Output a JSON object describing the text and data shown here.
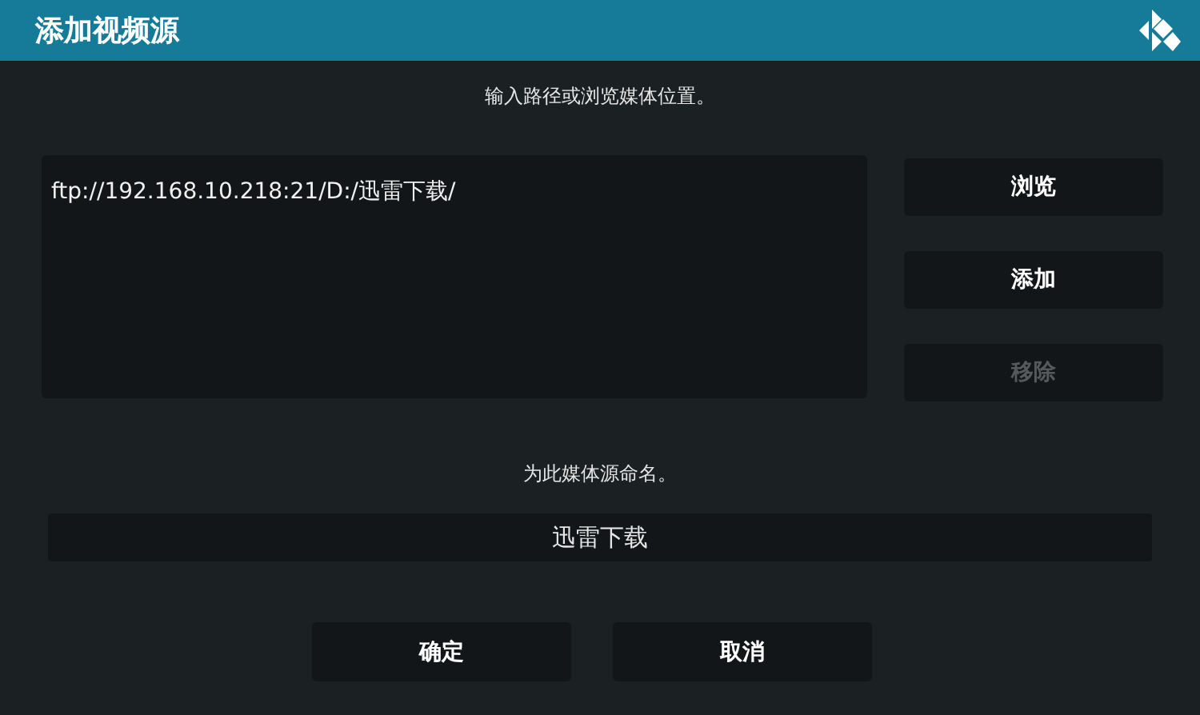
{
  "window": {
    "title": "添加视频源"
  },
  "path_prompt": "输入路径或浏览媒体位置。",
  "paths": [
    {
      "text": "ftp://192.168.10.218:21/D:/迅雷下载/"
    }
  ],
  "side_buttons": [
    {
      "label": "浏览",
      "disabled": false
    },
    {
      "label": "添加",
      "disabled": false
    },
    {
      "label": "移除",
      "disabled": true
    }
  ],
  "name_prompt": "为此媒体源命名。",
  "name_field": {
    "value": "迅雷下载"
  },
  "buttons": [
    {
      "label": "确定"
    },
    {
      "label": "取消"
    }
  ]
}
